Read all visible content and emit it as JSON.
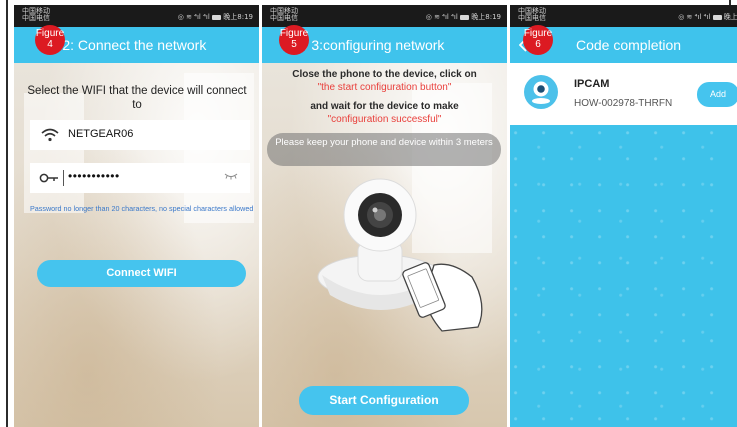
{
  "statusbar": {
    "carrier_line1": "中国移动",
    "carrier_line2": "中国电信",
    "icons_time_1": "◎ ≋ ⁴ıl ⁴ıl",
    "time_1": "晚上8:19",
    "time_2": "晚上8:19",
    "time_3": "晚上8:2"
  },
  "screen1": {
    "badge_label": "Figure",
    "badge_num": "4",
    "title": "tep 2: Connect the network",
    "instruction": "Select the WIFI that the device will connect to",
    "wifi_ssid": "NETGEAR06",
    "password_mask": "•••••••••••",
    "hint": "Password no longer than 20 characters, no special characters allowed",
    "connect_button": "Connect WIFI"
  },
  "screen2": {
    "badge_label": "Figure",
    "badge_num": "5",
    "title": "etp 3:configuring network",
    "line1": "Close the phone to the device, click on",
    "red1": "\"the start configuration button\"",
    "line2": "and wait for the device to make",
    "red2": "\"configuration successful\"",
    "notice": "Please keep your phone and device within 3 meters",
    "start_button": "Start Configuration"
  },
  "screen3": {
    "badge_label": "Figure",
    "badge_num": "6",
    "title": "Code completion",
    "device_name": "IPCAM",
    "device_id": "HOW-002978-THRFN",
    "add_button": "Add"
  },
  "colors": {
    "accent": "#3fc3ec",
    "button": "#45c4ee",
    "badge": "#dc1a22",
    "highlight_red": "#e9403c"
  }
}
